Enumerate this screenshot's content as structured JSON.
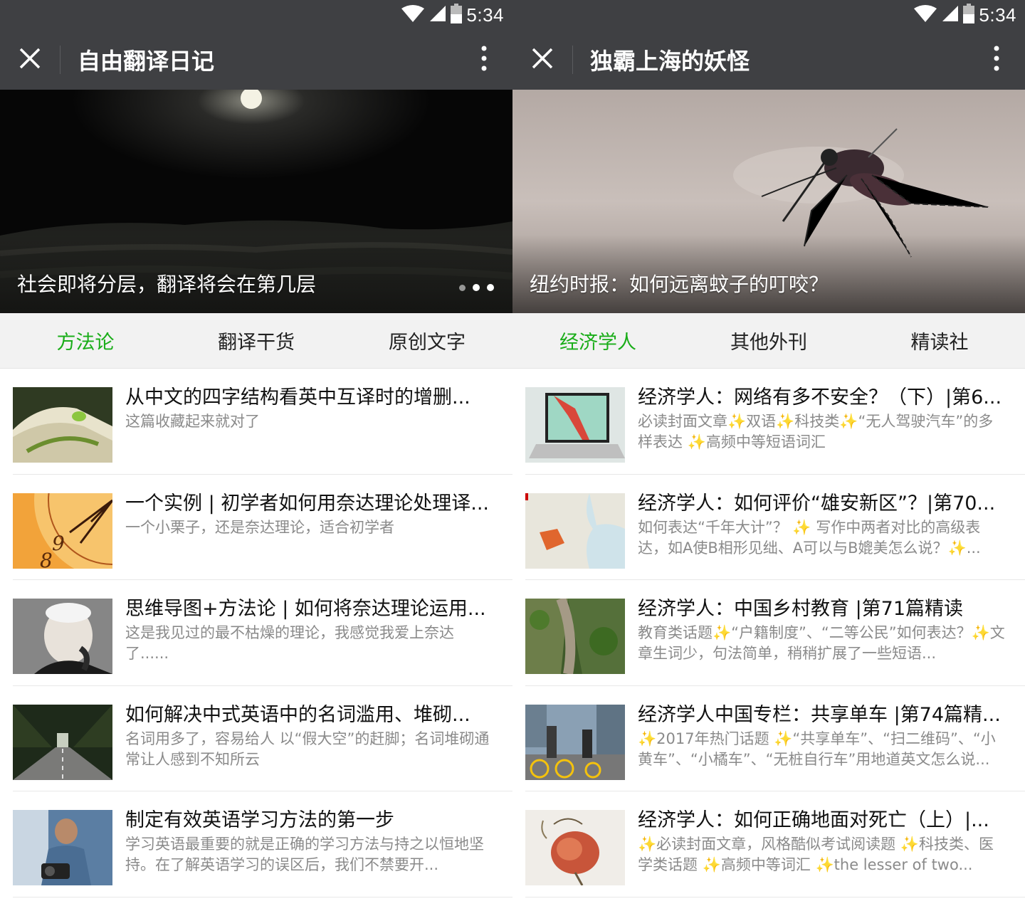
{
  "screens": [
    {
      "status": {
        "time": "5:34"
      },
      "title": "自由翻译日记",
      "banner": {
        "caption": "社会即将分层，翻译将会在第几层"
      },
      "tabs": [
        {
          "label": "方法论",
          "active": true
        },
        {
          "label": "翻译干货",
          "active": false
        },
        {
          "label": "原创文字",
          "active": false
        }
      ],
      "articles": [
        {
          "title": "从中文的四字结构看英中互译时的增删...",
          "desc": "这篇收藏起来就对了"
        },
        {
          "title": "一个实例 | 初学者如何用奈达理论处理译...",
          "desc": "一个小栗子，还是奈达理论，适合初学者"
        },
        {
          "title": "思维导图+方法论 | 如何将奈达理论运用...",
          "desc": "这是我见过的最不枯燥的理论，我感觉我爱上奈达了......"
        },
        {
          "title": "如何解决中式英语中的名词滥用、堆砌...",
          "desc": "名词用多了，容易给人 以“假大空”的赶脚；名词堆砌通常让人感到不知所云"
        },
        {
          "title": "制定有效英语学习方法的第一步",
          "desc": "学习英语最重要的就是正确的学习方法与持之以恒地坚持。在了解英语学习的误区后，我们不禁要开..."
        }
      ]
    },
    {
      "status": {
        "time": "5:34"
      },
      "title": "独霸上海的妖怪",
      "banner": {
        "caption": "纽约时报：如何远离蚊子的叮咬？"
      },
      "tabs": [
        {
          "label": "经济学人",
          "active": true
        },
        {
          "label": "其他外刊",
          "active": false
        },
        {
          "label": "精读社",
          "active": false
        }
      ],
      "articles": [
        {
          "title": "经济学人：网络有多不安全？（下）|第6...",
          "desc": "必读封面文章✨双语✨科技类✨“无人驾驶汽车”的多样表达 ✨高频中等短语词汇"
        },
        {
          "title": "经济学人：如何评价“雄安新区”？|第70...",
          "desc": "如何表达“千年大计”？ ✨ 写作中两者对比的高级表达，如A使B相形见绌、A可以与B媲美怎么说？✨..."
        },
        {
          "title": "经济学人：中国乡村教育 |第71篇精读",
          "desc": "教育类话题✨“户籍制度”、“二等公民”如何表达？✨文章生词少，句法简单，稍稍扩展了一些短语..."
        },
        {
          "title": "经济学人中国专栏：共享单车 |第74篇精...",
          "desc": "✨2017年热门话题 ✨“共享单车”、“扫二维码”、“小黄车”、“小橘车”、“无桩自行车”用地道英文怎么说..."
        },
        {
          "title": "经济学人：如何正确地面对死亡（上）|...",
          "desc": "✨必读封面文章，风格酷似考试阅读题 ✨科技类、医学类话题 ✨高频中等词汇 ✨the lesser of two..."
        }
      ]
    }
  ],
  "colors": {
    "bar": "#3f4043",
    "accent_green": "#1aad19",
    "tab_bg": "#f2f2f2",
    "desc_gray": "#8a8a8a"
  },
  "icons": {
    "close": "close-icon",
    "more": "more-vertical-icon",
    "wifi": "wifi-icon",
    "signal": "signal-icon",
    "battery": "battery-icon"
  }
}
